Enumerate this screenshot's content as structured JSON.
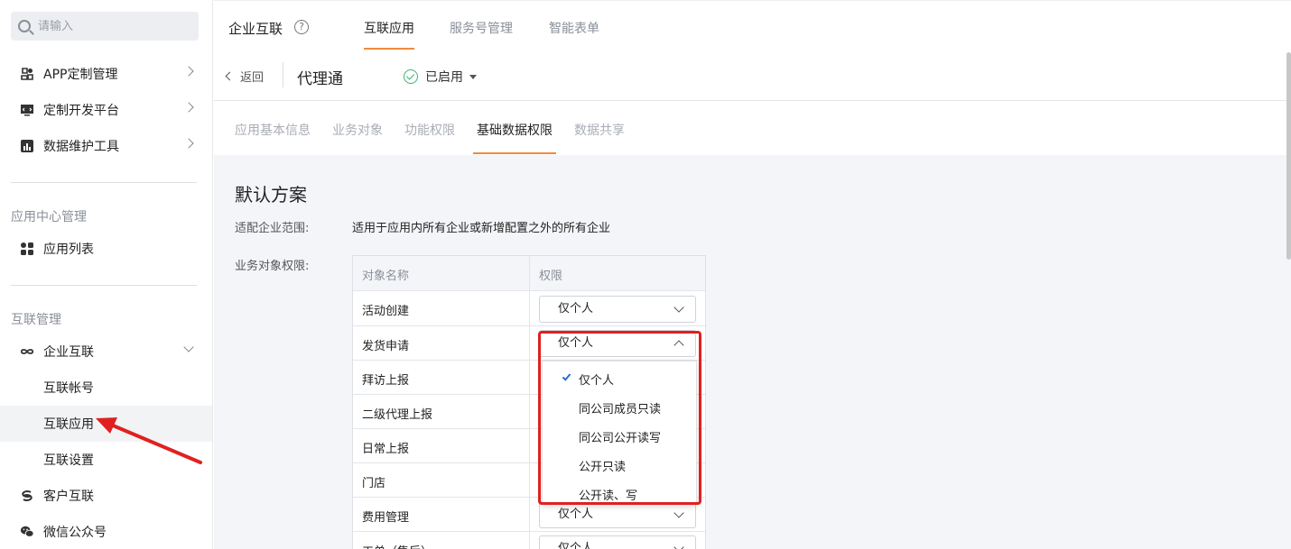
{
  "sidebar": {
    "search_placeholder": "请输入",
    "items": [
      {
        "label": "APP定制管理",
        "icon": "app-settings-icon"
      },
      {
        "label": "定制开发平台",
        "icon": "code-monitor-icon"
      },
      {
        "label": "数据维护工具",
        "icon": "chart-box-icon"
      }
    ],
    "section_app": "应用中心管理",
    "app_list": "应用列表",
    "section_interconnect": "互联管理",
    "enterprise": "企业互联",
    "sub_items": [
      "互联帐号",
      "互联应用",
      "互联设置"
    ],
    "customer": "客户互联",
    "wechat": "微信公众号"
  },
  "topbar": {
    "brand": "企业互联",
    "help": "?",
    "tabs": [
      "互联应用",
      "服务号管理",
      "智能表单"
    ]
  },
  "subbar": {
    "back": "返回",
    "app_name": "代理通",
    "status": "已启用"
  },
  "tabs": [
    "应用基本信息",
    "业务对象",
    "功能权限",
    "基础数据权限",
    "数据共享"
  ],
  "content": {
    "title": "默认方案",
    "scope_label": "适配企业范围:",
    "scope_value": "适用于应用内所有企业或新增配置之外的所有企业",
    "perm_label": "业务对象权限:",
    "table": {
      "headers": [
        "对象名称",
        "权限"
      ],
      "rows": [
        {
          "name": "活动创建",
          "perm": "仅个人"
        },
        {
          "name": "发货申请",
          "perm": "仅个人"
        },
        {
          "name": "拜访上报",
          "perm": ""
        },
        {
          "name": "二级代理上报",
          "perm": ""
        },
        {
          "name": "日常上报",
          "perm": ""
        },
        {
          "name": "门店",
          "perm": ""
        },
        {
          "name": "费用管理",
          "perm": "仅个人"
        },
        {
          "name": "工单（售后）",
          "perm": "仅个人"
        }
      ]
    },
    "dropdown_options": [
      "仅个人",
      "同公司成员只读",
      "同公司公开读写",
      "公开只读",
      "公开读、写"
    ],
    "selected_option": "仅个人"
  },
  "colors": {
    "accent": "#f08a3c",
    "highlight": "#e02020",
    "check": "#2a6dd6",
    "status_green": "#3cb371"
  }
}
